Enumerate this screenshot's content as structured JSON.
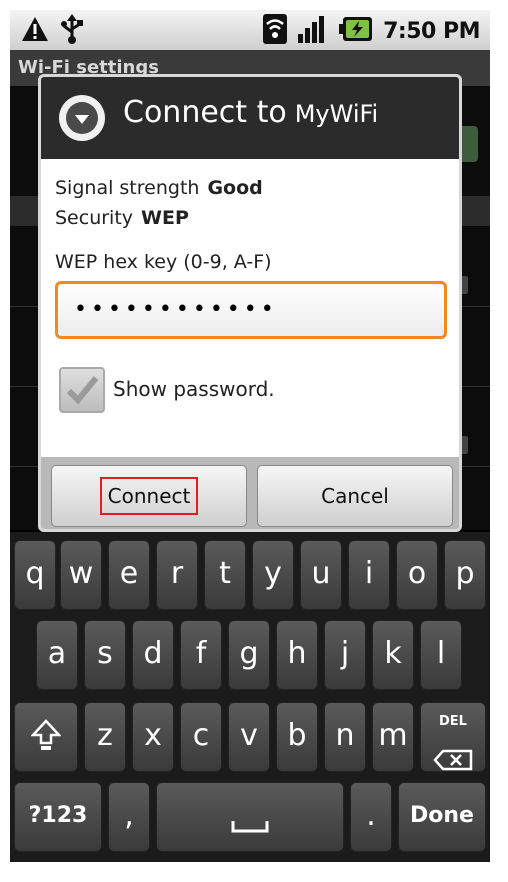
{
  "status_bar": {
    "time": "7:50 PM",
    "icons": [
      "warning-icon",
      "usb-icon",
      "wifi-icon",
      "signal-icon",
      "battery-icon"
    ]
  },
  "background_screen": {
    "title": "Wi-Fi settings"
  },
  "dialog": {
    "title": "Connect to",
    "ssid": "MyWiFi",
    "signal_label": "Signal strength",
    "signal_value": "Good",
    "security_label": "Security",
    "security_value": "WEP",
    "key_label": "WEP hex key (0-9, A-F)",
    "password_masked": "••••••••••••",
    "show_password_label": "Show password.",
    "show_password_checked": true,
    "connect_label": "Connect",
    "cancel_label": "Cancel"
  },
  "keyboard": {
    "row1": [
      "q",
      "w",
      "e",
      "r",
      "t",
      "y",
      "u",
      "i",
      "o",
      "p"
    ],
    "row2": [
      "a",
      "s",
      "d",
      "f",
      "g",
      "h",
      "j",
      "k",
      "l"
    ],
    "row3": [
      "z",
      "x",
      "c",
      "v",
      "b",
      "n",
      "m"
    ],
    "del_label": "DEL",
    "symbols_label": "?123",
    "comma_label": ",",
    "period_label": ".",
    "done_label": "Done"
  },
  "colors": {
    "focus_orange": "#f08a1c",
    "highlight_red": "#e02020",
    "battery_green": "#7fc242"
  }
}
